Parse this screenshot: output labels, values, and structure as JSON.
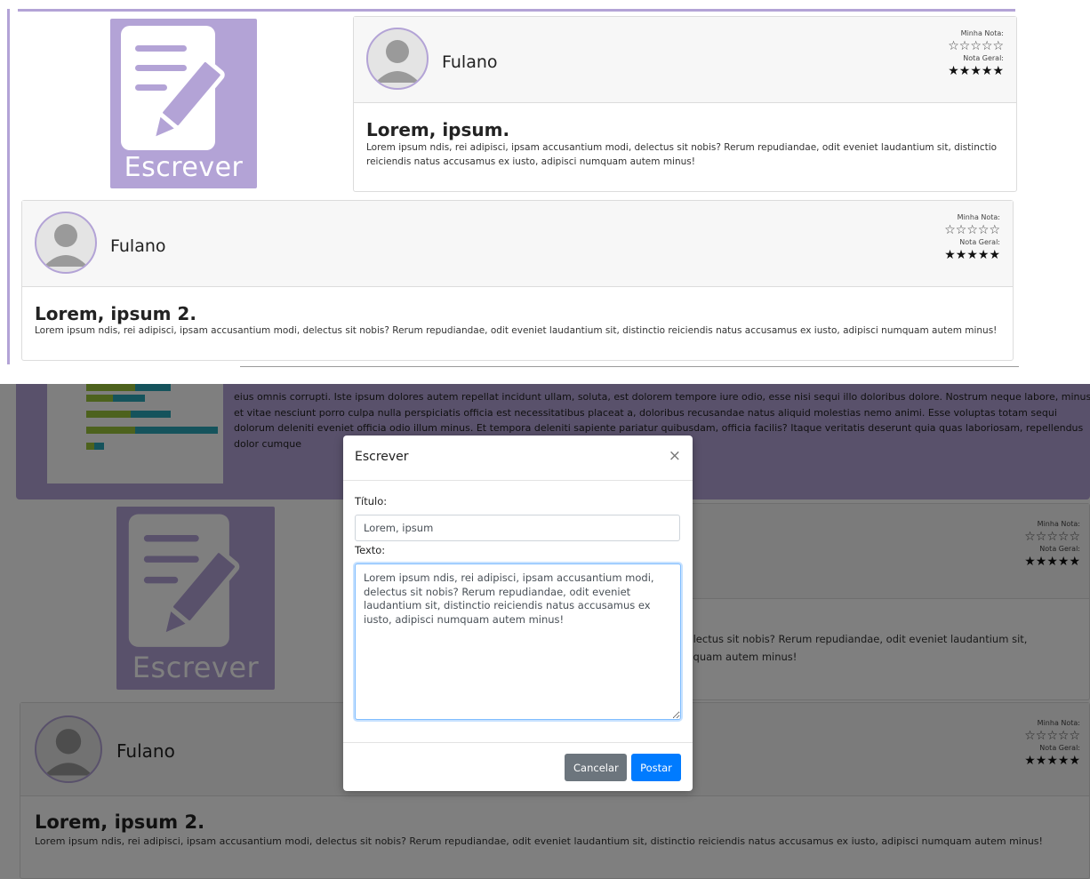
{
  "colors": {
    "accent_purple": "#b3a3d6",
    "overlay": "#000000",
    "primary_button": "#007bff",
    "secondary_button": "#6c757d",
    "focus_border": "#80bdff"
  },
  "escrever_tile": {
    "label": "Escrever",
    "icon": "pencil-paper-icon"
  },
  "posts": [
    {
      "author": "Fulano",
      "my_rating_label": "Minha Nota:",
      "my_rating_stars": "☆☆☆☆☆",
      "overall_rating_label": "Nota Geral:",
      "overall_rating_stars": "★★★★★",
      "title": "Lorem, ipsum.",
      "body": "Lorem ipsum ndis, rei adipisci, ipsam accusantium modi, delectus sit nobis? Rerum repudiandae, odit eveniet laudantium sit, distinctio reiciendis natus accusamus ex iusto, adipisci numquam autem minus!"
    },
    {
      "author": "Fulano",
      "my_rating_label": "Minha Nota:",
      "my_rating_stars": "☆☆☆☆☆",
      "overall_rating_label": "Nota Geral:",
      "overall_rating_stars": "★★★★★",
      "title": "Lorem, ipsum 2.",
      "body": "Lorem ipsum ndis, rei adipisci, ipsam accusantium modi, delectus sit nobis? Rerum repudiandae, odit eveniet laudantium sit, distinctio reiciendis natus accusamus ex iusto, adipisci numquam autem minus!"
    }
  ],
  "background_banner": {
    "text": "eius omnis corrupti. Iste ipsum dolores autem repellat incidunt ullam, soluta, est dolorem tempore iure odio, esse nisi sequi illo doloribus dolore. Nostrum neque labore, minus et vitae nesciunt porro culpa nulla perspiciatis officia est necessitatibus placeat a, doloribus recusandae natus aliquid molestias nemo animi. Esse voluptas totam sequi dolorum deleniti eveniet officia odio illum minus. Et tempora deleniti sapiente pariatur quibusdam, officia facilis? Itaque veritatis deserunt quia quas laboriosam, repellendus dolor cumque"
  },
  "modal": {
    "title": "Escrever",
    "close_symbol": "×",
    "title_label": "Título:",
    "title_value": "Lorem, ipsum",
    "text_label": "Texto:",
    "text_value": "Lorem ipsum ndis, rei adipisci, ipsam accusantium modi, delectus sit nobis? Rerum repudiandae, odit eveniet laudantium sit, distinctio reiciendis natus accusamus ex iusto, adipisci numquam autem minus!",
    "cancel_label": "Cancelar",
    "post_label": "Postar"
  }
}
